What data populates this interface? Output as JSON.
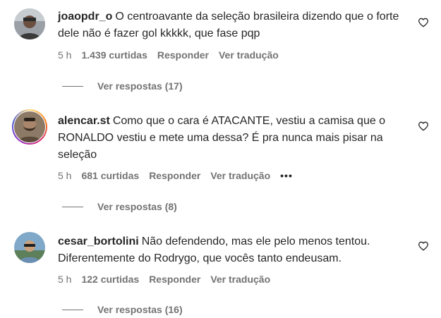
{
  "comments": [
    {
      "username": "joaopdr_o",
      "text": "O centroavante da seleção brasileira dizendo que o forte dele não é fazer gol kkkkk, que fase pqp",
      "time": "5 h",
      "likes": "1.439 curtidas",
      "reply_label": "Responder",
      "translate_label": "Ver tradução",
      "view_replies": "Ver respostas (17)"
    },
    {
      "username": "alencar.st",
      "text": "Como que o cara é ATACANTE, vestiu a camisa que o RONALDO vestiu e mete uma dessa? É pra nunca mais pisar na seleção",
      "time": "5 h",
      "likes": "681 curtidas",
      "reply_label": "Responder",
      "translate_label": "Ver tradução",
      "more_label": "•••",
      "view_replies": "Ver respostas (8)"
    },
    {
      "username": "cesar_bortolini",
      "text": "Não defendendo, mas ele pelo menos tentou. Diferentemente do Rodrygo, que vocês tanto endeusam.",
      "time": "5 h",
      "likes": "122 curtidas",
      "reply_label": "Responder",
      "translate_label": "Ver tradução",
      "view_replies": "Ver respostas (16)"
    }
  ],
  "icons": {
    "like": "heart-outline-icon",
    "more": "more-options-icon"
  },
  "colors": {
    "primary_text": "#262626",
    "secondary_text": "#737373"
  }
}
